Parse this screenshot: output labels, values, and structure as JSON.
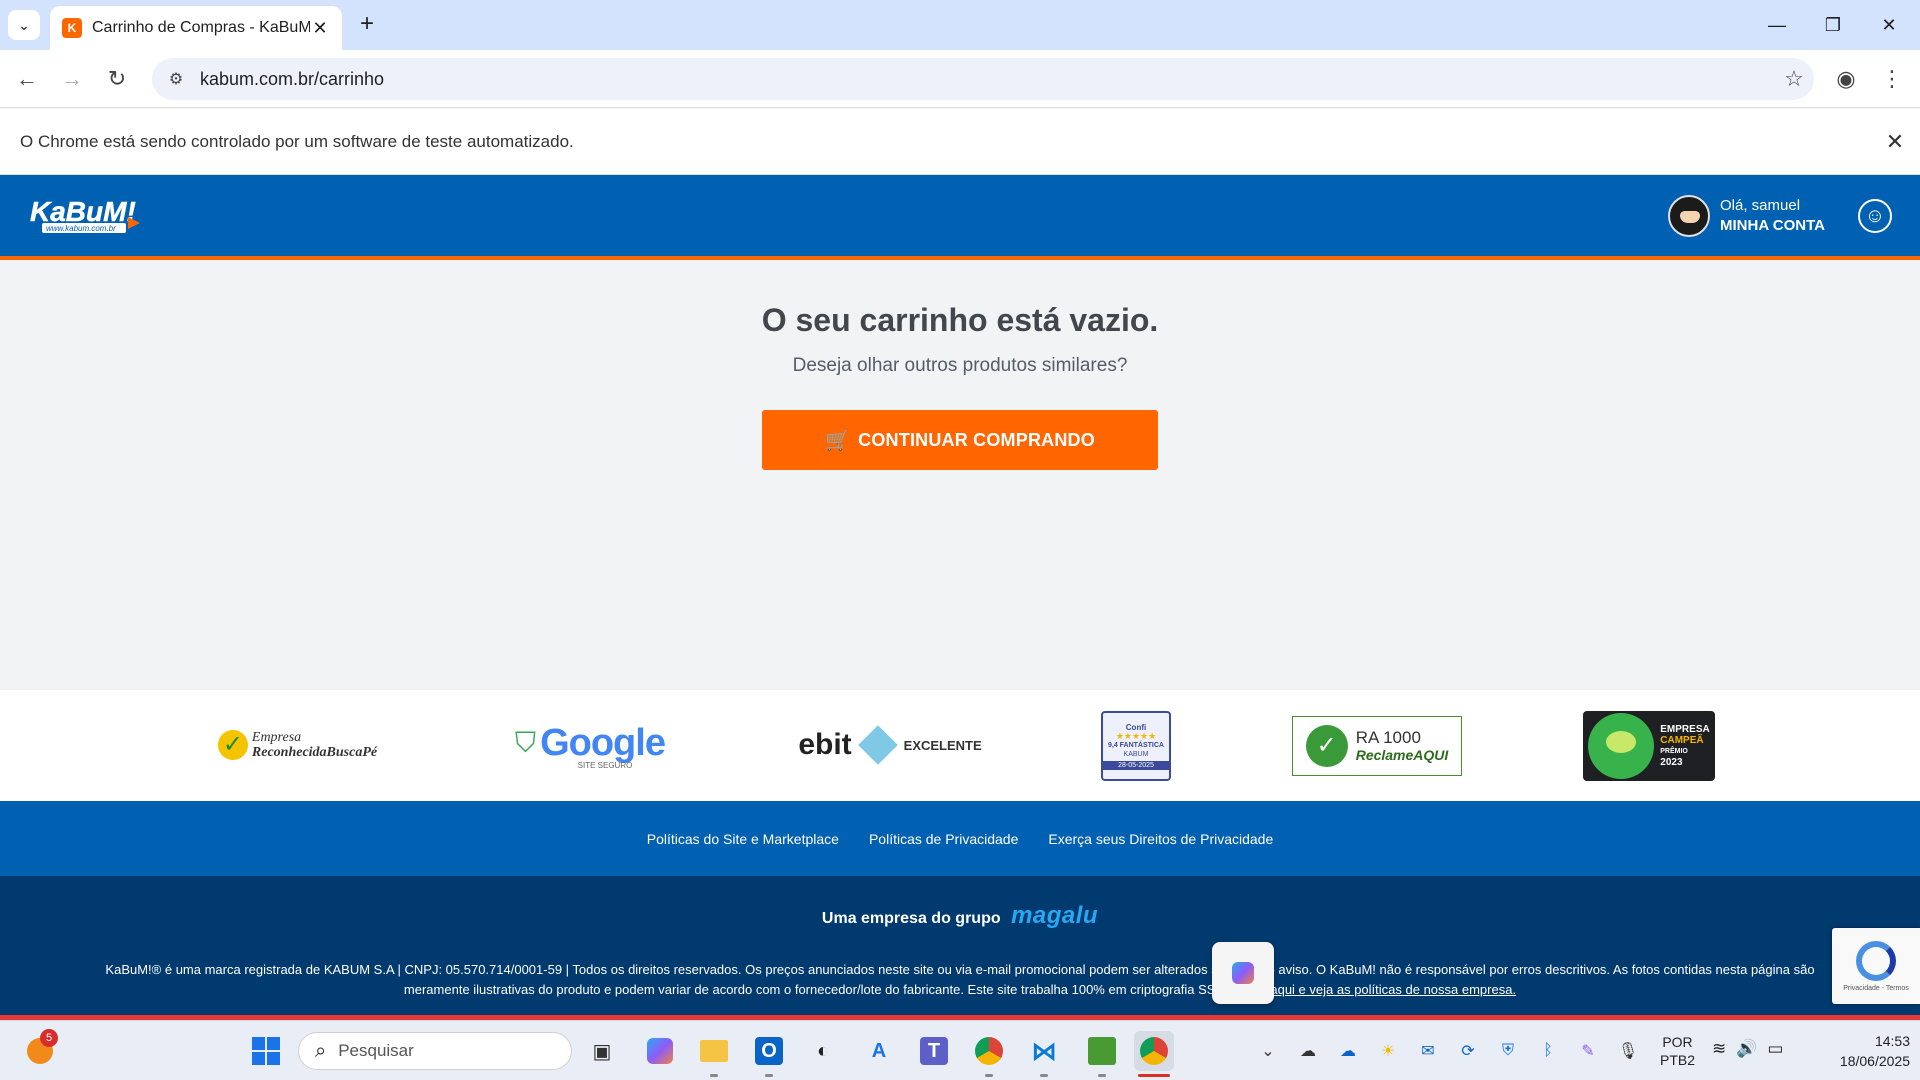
{
  "browser": {
    "tab_title": "Carrinho de Compras - KaBuM!",
    "url": "kabum.com.br/carrinho",
    "automation_notice": "O Chrome está sendo controlado por um software de teste automatizado."
  },
  "header": {
    "logo_text": "KaBuM!",
    "logo_subtext": "www.kabum.com.br",
    "greeting": "Olá, samuel",
    "account_label": "MINHA CONTA"
  },
  "cart": {
    "empty_title": "O seu carrinho está vazio.",
    "empty_subtitle": "Deseja olhar outros produtos similares?",
    "continue_button": "CONTINUAR COMPRANDO"
  },
  "seals": {
    "buscape_line1": "Empresa",
    "buscape_line2": "ReconhecidaBuscaPé",
    "google_text": "Google",
    "google_sub": "SITE SEGURO",
    "ebit_text": "ebit",
    "ebit_rating": "EXCELENTE",
    "confi_brand": "Confi",
    "confi_stars": "★★★★★",
    "confi_score": "9,4 FANTÁSTICA",
    "confi_store": "KABUM",
    "confi_date": "28-05-2025",
    "ra_score": "RA 1000",
    "ra_brand": "ReclameAQUI",
    "campea_line1": "EMPRESA",
    "campea_line2": "CAMPEÃ",
    "campea_line3": "PRÊMIO",
    "campea_year": "2023"
  },
  "footer": {
    "links": [
      "Políticas do Site e Marketplace",
      "Políticas de Privacidade",
      "Exerça seus Direitos de Privacidade"
    ],
    "group_text": "Uma empresa do grupo",
    "group_brand": "magalu",
    "legal_text": "KaBuM!® é uma marca registrada de KABUM S.A | CNPJ: 05.570.714/0001-59 | Todos os direitos reservados. Os preços anunciados neste site ou via e-mail promocional podem ser alterados sem prévio aviso. O KaBuM! não é responsável por erros descritivos. As fotos contidas nesta página são meramente ilustrativas do produto e podem variar de acordo com o fornecedor/lote do fabricante. Este site trabalha 100% em criptografia SSL.",
    "legal_link": "Clique aqui e veja as políticas de nossa empresa.",
    "recaptcha_text": "Privacidade - Termos"
  },
  "taskbar": {
    "weather_badge": "5",
    "search_placeholder": "Pesquisar",
    "lang_line1": "POR",
    "lang_line2": "PTB2",
    "time": "14:53",
    "date": "18/06/2025"
  },
  "colors": {
    "brand_blue": "#0060b1",
    "brand_orange": "#ff6500",
    "footer_dark": "#003a6e"
  }
}
